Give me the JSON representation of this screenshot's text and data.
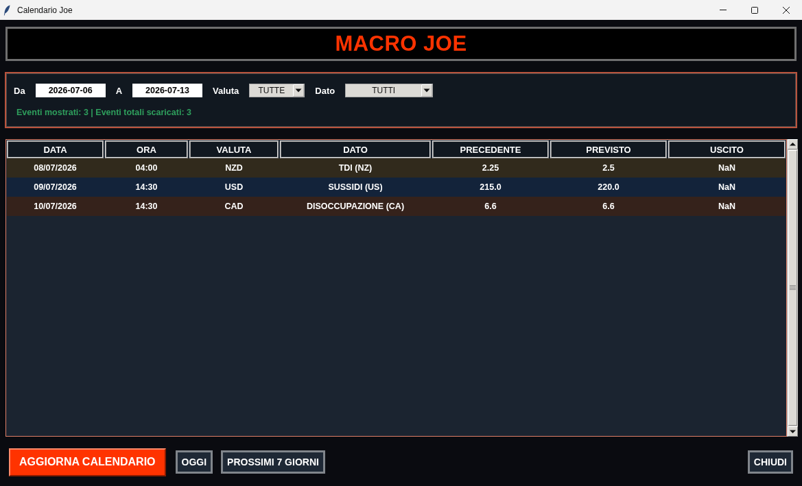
{
  "window": {
    "title": "Calendario Joe"
  },
  "header": {
    "title": "MACRO JOE"
  },
  "filters": {
    "fields": [
      {
        "kind": "date",
        "label": "Da",
        "value": "2026-07-06"
      },
      {
        "kind": "date",
        "label": "A",
        "value": "2026-07-13"
      },
      {
        "kind": "dropdown",
        "label": "Valuta",
        "value": "TUTTE"
      },
      {
        "kind": "dropdown",
        "label": "Dato",
        "value": "TUTTI"
      }
    ],
    "status": "Eventi mostrati: 3 | Eventi totali scaricati: 3"
  },
  "table": {
    "columns": [
      "DATA",
      "ORA",
      "VALUTA",
      "DATO",
      "PRECEDENTE",
      "PREVISTO",
      "USCITO"
    ],
    "rows": [
      {
        "color": "#312a1c",
        "cells": [
          "08/07/2026",
          "04:00",
          "NZD",
          "TDI (NZ)",
          "2.25",
          "2.5",
          "NaN"
        ]
      },
      {
        "color": "#13233a",
        "cells": [
          "09/07/2026",
          "14:30",
          "USD",
          "SUSSIDI (US)",
          "215.0",
          "220.0",
          "NaN"
        ]
      },
      {
        "color": "#35221b",
        "cells": [
          "10/07/2026",
          "14:30",
          "CAD",
          "DISOCCUPAZIONE (CA)",
          "6.6",
          "6.6",
          "NaN"
        ]
      }
    ]
  },
  "buttons": [
    {
      "kind": "primary",
      "label": "AGGIORNA CALENDARIO"
    },
    {
      "kind": "secondary",
      "label": "OGGI"
    },
    {
      "kind": "secondary",
      "label": "PROSSIMI 7 GIORNI"
    }
  ],
  "close_button": {
    "label": "CHIUDI"
  }
}
